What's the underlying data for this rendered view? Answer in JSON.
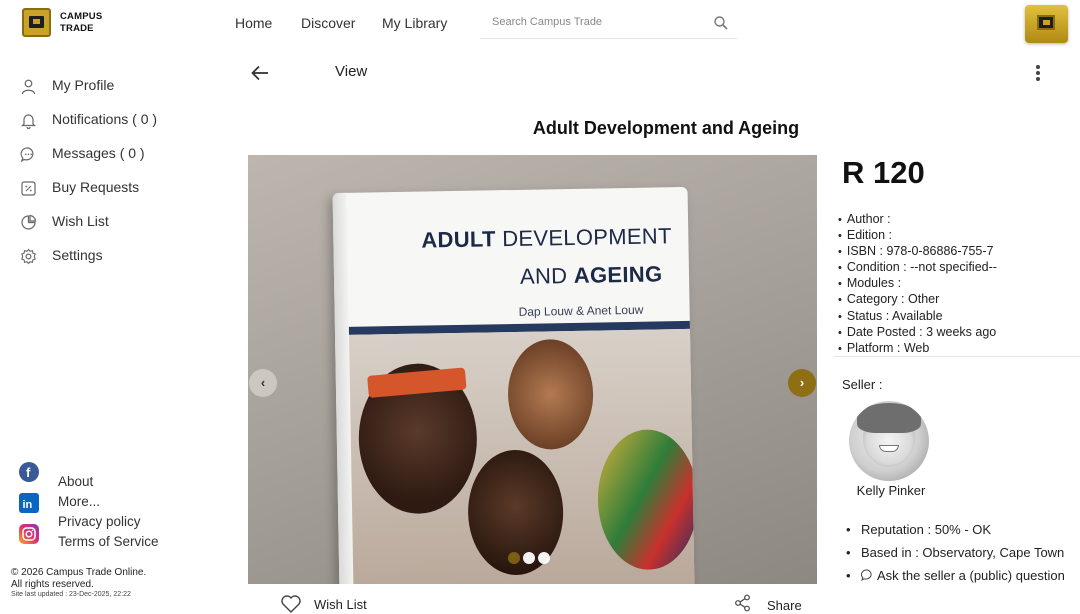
{
  "header": {
    "brand_line1": "CAMPUS",
    "brand_line2": "TRADE",
    "nav": [
      "Home",
      "Discover",
      "My Library"
    ],
    "search_placeholder": "Search Campus Trade"
  },
  "sidebar": {
    "items": [
      {
        "label": "My Profile",
        "icon": "user-icon"
      },
      {
        "label": "Notifications ( 0 )",
        "icon": "bell-icon"
      },
      {
        "label": "Messages ( 0 )",
        "icon": "chat-icon"
      },
      {
        "label": "Buy Requests",
        "icon": "tag-icon"
      },
      {
        "label": "Wish List",
        "icon": "pie-icon"
      },
      {
        "label": "Settings",
        "icon": "gear-icon"
      }
    ],
    "footer_links": [
      "About",
      "More...",
      "Privacy policy",
      "Terms of Service"
    ],
    "social_icons": [
      "facebook-icon",
      "linkedin-icon",
      "instagram-icon"
    ],
    "copyright": "© 2026 Campus Trade Online.",
    "rights": "All rights reserved.",
    "updated": "Site last updated : 23-Dec-2025, 22:22"
  },
  "view": {
    "title": "View",
    "book_title": "Adult Development and Ageing"
  },
  "cover": {
    "line1_bold": "ADULT",
    "line1_rest": " DEVELOPMENT",
    "line2_pre": "AND ",
    "line2_bold": "AGEING",
    "authors": "Dap Louw & Anet Louw"
  },
  "carousel": {
    "prev": "‹",
    "next": "›",
    "dot_count": 3,
    "active_dot": 0
  },
  "actions": {
    "wish_label": "Wish List",
    "share_label": "Share"
  },
  "listing": {
    "price": "R 120",
    "details": [
      "Author :",
      "Edition :",
      "ISBN : 978-0-86886-755-7",
      "Condition : --not specified--",
      "Modules :",
      "Category : Other",
      "Status : Available",
      "Date Posted : 3 weeks ago",
      "Platform : Web"
    ]
  },
  "seller": {
    "label": "Seller :",
    "name": "Kelly Pinker",
    "reputation": "Reputation : 50% - OK",
    "based_in": "Based in : Observatory, Cape Town",
    "ask": "Ask the seller a (public) question"
  },
  "colors": {
    "accent_gold": "#c9a227",
    "next_button": "#8e6f14",
    "facebook": "#3b5998",
    "linkedin": "#0a66c2",
    "instagram": "#c13584"
  }
}
